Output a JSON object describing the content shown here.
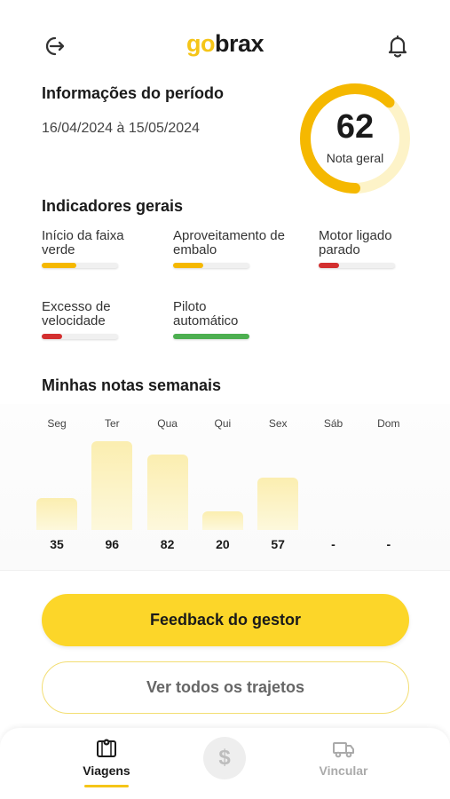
{
  "header": {
    "logo_part1": "go",
    "logo_part2": "brax"
  },
  "period": {
    "title": "Informações do período",
    "dates": "16/04/2024 à 15/05/2024"
  },
  "score": {
    "value": "62",
    "label": "Nota geral",
    "fraction": 0.62,
    "color": "#f5b800",
    "track_color": "#fdf3c8"
  },
  "indicators": {
    "title": "Indicadores gerais",
    "items": [
      {
        "label": "Início da faixa verde",
        "level": 0.45,
        "color": "#f5b800"
      },
      {
        "label": "Aproveitamento de embalo",
        "level": 0.4,
        "color": "#f5b800"
      },
      {
        "label": "Motor ligado parado",
        "level": 0.27,
        "color": "#d32f2f"
      },
      {
        "label": "Excesso de velocidade",
        "level": 0.27,
        "color": "#d32f2f"
      },
      {
        "label": "Piloto automático",
        "level": 1.0,
        "color": "#4caf50"
      }
    ]
  },
  "weekly": {
    "title": "Minhas notas semanais",
    "days": [
      "Seg",
      "Ter",
      "Qua",
      "Qui",
      "Sex",
      "Sáb",
      "Dom"
    ],
    "values": [
      "35",
      "96",
      "82",
      "20",
      "57",
      "-",
      "-"
    ]
  },
  "chart_data": {
    "type": "bar",
    "categories": [
      "Seg",
      "Ter",
      "Qua",
      "Qui",
      "Sex",
      "Sáb",
      "Dom"
    ],
    "values": [
      35,
      96,
      82,
      20,
      57,
      null,
      null
    ],
    "title": "Minhas notas semanais",
    "ylim": [
      0,
      100
    ]
  },
  "actions": {
    "feedback_label": "Feedback do gestor",
    "trips_label": "Ver todos os trajetos"
  },
  "nav": {
    "trips_label": "Viagens",
    "center_glyph": "$",
    "link_label": "Vincular",
    "active_color": "#f5c518",
    "inactive_color": "#aaaaaa"
  }
}
